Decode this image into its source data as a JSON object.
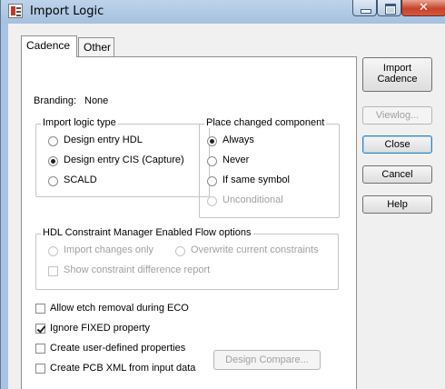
{
  "window": {
    "title": "Import Logic"
  },
  "tabs": [
    {
      "label": "Cadence",
      "active": true
    },
    {
      "label": "Other",
      "active": false
    }
  ],
  "branding": {
    "label": "Branding:",
    "value": "None"
  },
  "import_logic_type": {
    "title": "Import logic type",
    "options": [
      {
        "label": "Design entry HDL",
        "checked": false
      },
      {
        "label": "Design entry CIS (Capture)",
        "checked": true
      },
      {
        "label": "SCALD",
        "checked": false
      }
    ]
  },
  "place_changed_component": {
    "title": "Place changed component",
    "options": [
      {
        "label": "Always",
        "checked": true
      },
      {
        "label": "Never",
        "checked": false
      },
      {
        "label": "If same symbol",
        "checked": false
      },
      {
        "label": "Unconditional",
        "checked": false,
        "disabled": true
      }
    ]
  },
  "hdl_flow": {
    "title": "HDL Constraint Manager Enabled Flow options",
    "import_changes_only": "Import changes only",
    "overwrite_current": "Overwrite current constraints",
    "show_diff_report": "Show constraint difference report"
  },
  "checkboxes": [
    {
      "label": "Allow etch removal during ECO",
      "checked": false
    },
    {
      "label": "Ignore FIXED property",
      "checked": true
    },
    {
      "label": "Create user-defined properties",
      "checked": false
    },
    {
      "label": "Create PCB XML from input data",
      "checked": false
    }
  ],
  "design_compare_button": "Design Compare...",
  "side_buttons": {
    "import_cadence_line1": "Import",
    "import_cadence_line2": "Cadence",
    "viewlog": "Viewlog...",
    "close": "Close",
    "cancel": "Cancel",
    "help": "Help"
  },
  "colors": {
    "titlebar": "#a9c4e0",
    "close_button": "#c7432b",
    "dialog_face": "#f0f0f0",
    "disabled_text": "#a0a0a0"
  }
}
